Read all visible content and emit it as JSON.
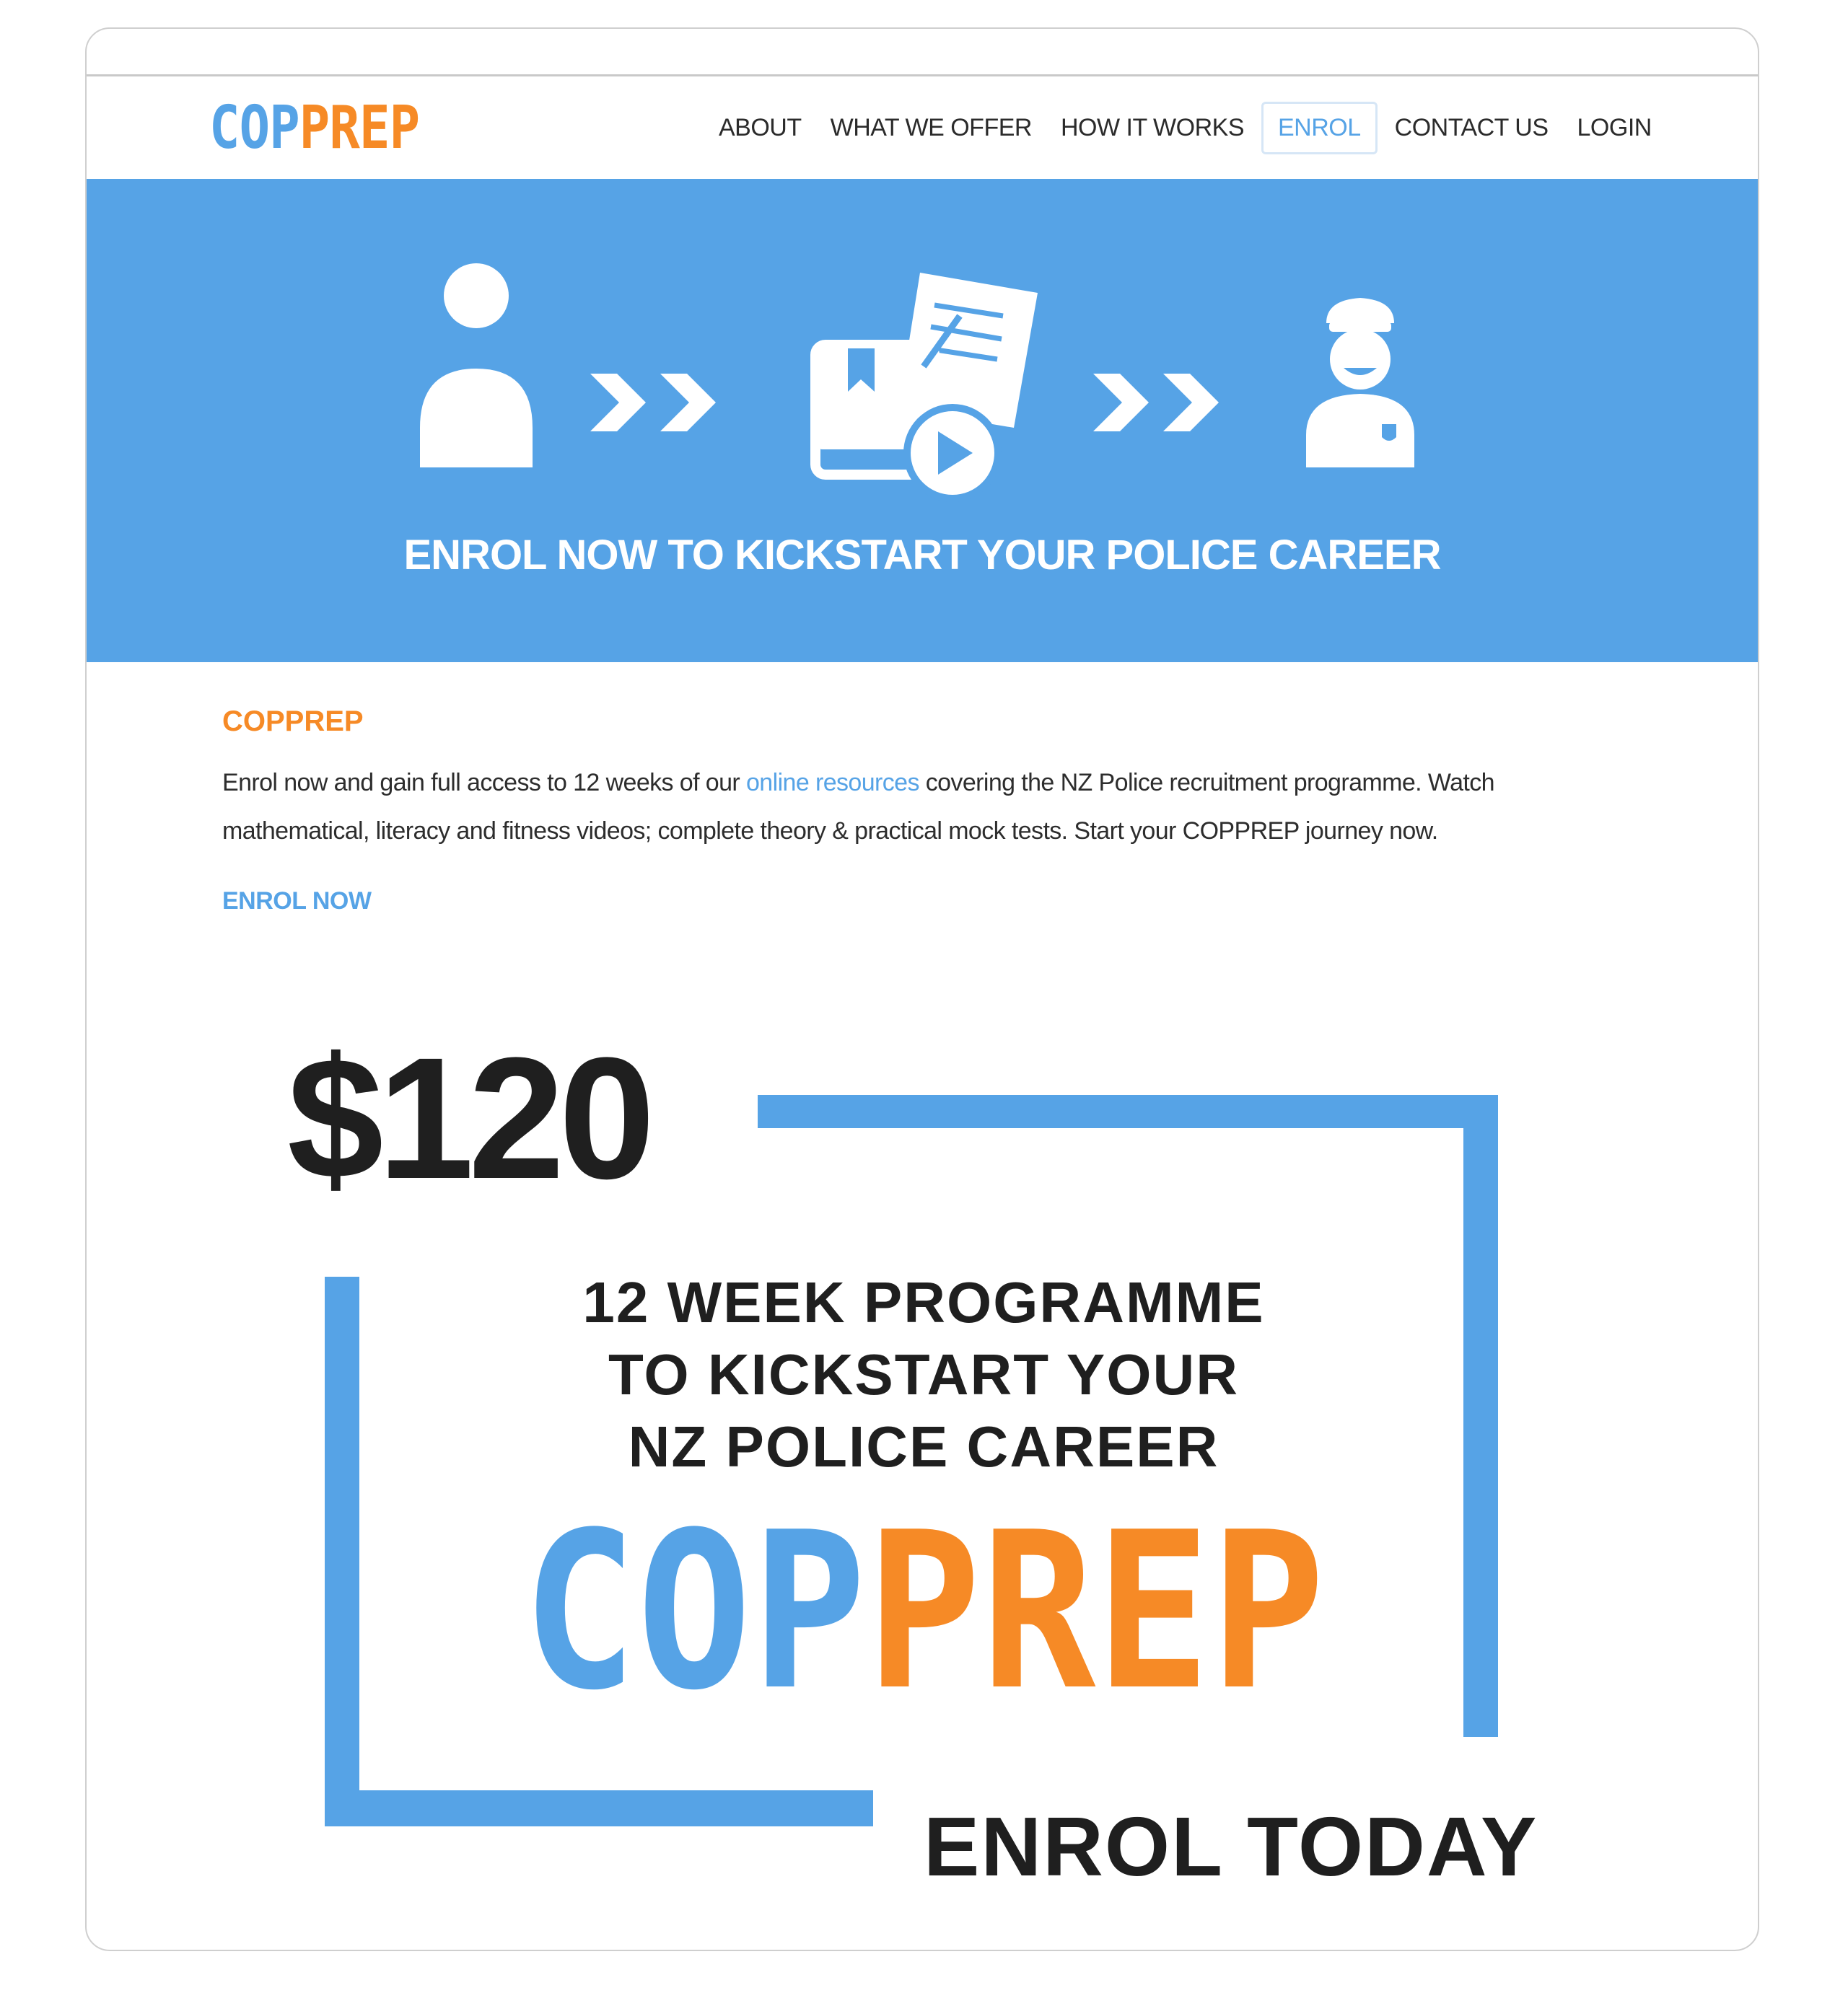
{
  "header": {
    "logo": {
      "part1": "COP",
      "part2": "PREP"
    },
    "nav": [
      {
        "label": "ABOUT",
        "active": false
      },
      {
        "label": "WHAT WE OFFER",
        "active": false
      },
      {
        "label": "HOW IT WORKS",
        "active": false
      },
      {
        "label": "ENROL",
        "active": true
      },
      {
        "label": "CONTACT US",
        "active": false
      },
      {
        "label": "LOGIN",
        "active": false
      }
    ]
  },
  "hero": {
    "title": "ENROL NOW TO KICKSTART YOUR POLICE CAREER",
    "icons": [
      "user-icon",
      "double-chevron-icon",
      "study-materials-icon",
      "double-chevron-icon",
      "police-officer-icon"
    ]
  },
  "content": {
    "section_title": "COPPREP",
    "paragraph": {
      "before_link": "Enrol now and gain full access to 12 weeks of our ",
      "link": "online resources",
      "after_link": " covering the NZ Police recruitment programme. Watch mathematical, literacy and fitness videos; complete theory & practical mock tests. Start your COPPREP journey now."
    },
    "enrol_link": "ENROL NOW"
  },
  "promo": {
    "price": "$120",
    "lines": [
      "12 WEEK PROGRAMME",
      "TO KICKSTART YOUR",
      "NZ POLICE CAREER"
    ],
    "logo": {
      "part1": "COP",
      "part2": "PREP"
    },
    "cta": "ENROL TODAY"
  },
  "colors": {
    "blue": "#56a3e6",
    "orange": "#f68a26",
    "dark": "#1f1f1f"
  }
}
